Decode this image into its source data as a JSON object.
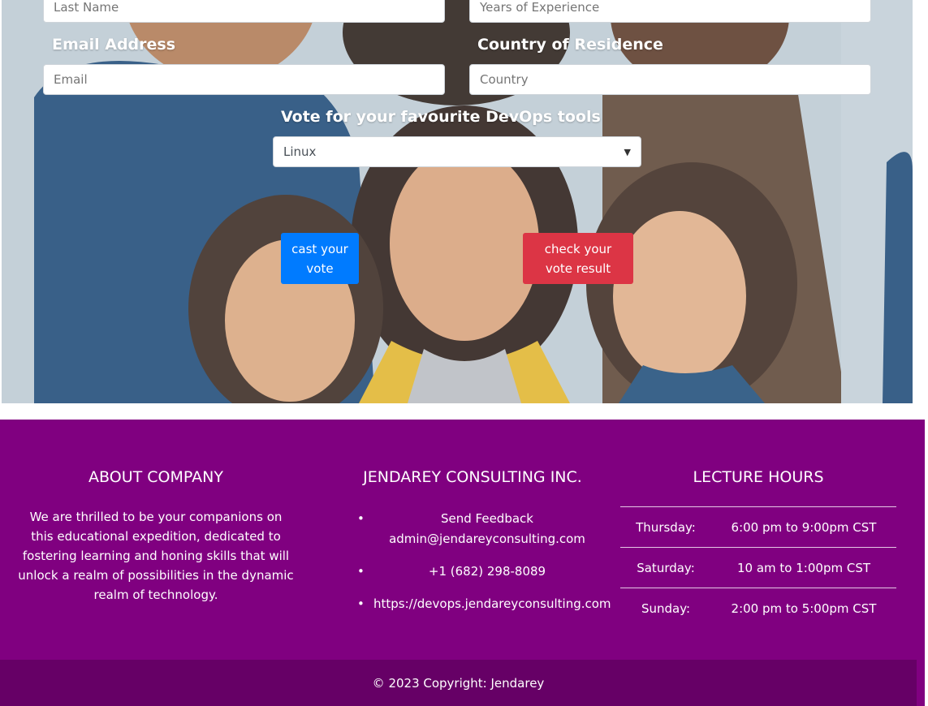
{
  "form": {
    "last_name_placeholder": "Last Name",
    "experience_placeholder": "Years of Experience",
    "email_label": "Email Address",
    "email_placeholder": "Email",
    "country_label": "Country of Residence",
    "country_placeholder": "Country",
    "vote_label": "Vote for your favourite DevOps tools",
    "vote_selected": "Linux",
    "cast_vote_label": "cast your vote",
    "check_result_label": "check your vote result"
  },
  "footer": {
    "about_title": "ABOUT COMPANY",
    "about_text": "We are thrilled to be your companions on this educational expedition, dedicated to fostering learning and honing skills that will unlock a realm of possibilities in the dynamic realm of technology.",
    "company_title": "JENDAREY CONSULTING INC.",
    "contacts": [
      "Send Feedback admin@jendareyconsulting.com",
      "+1 (682) 298-8089",
      "https://devops.jendareyconsulting.com"
    ],
    "hours_title": "LECTURE HOURS",
    "hours": [
      {
        "day": "Thursday:",
        "time": "6:00 pm to 9:00pm CST"
      },
      {
        "day": "Saturday:",
        "time": "10 am to 1:00pm CST"
      },
      {
        "day": "Sunday:",
        "time": "2:00 pm to 5:00pm CST"
      }
    ],
    "copyright": "© 2023 Copyright: Jendarey"
  },
  "colors": {
    "footer_bg": "#800080",
    "copyright_bg": "#660066",
    "primary_button": "#007bff",
    "danger_button": "#dc3545"
  }
}
